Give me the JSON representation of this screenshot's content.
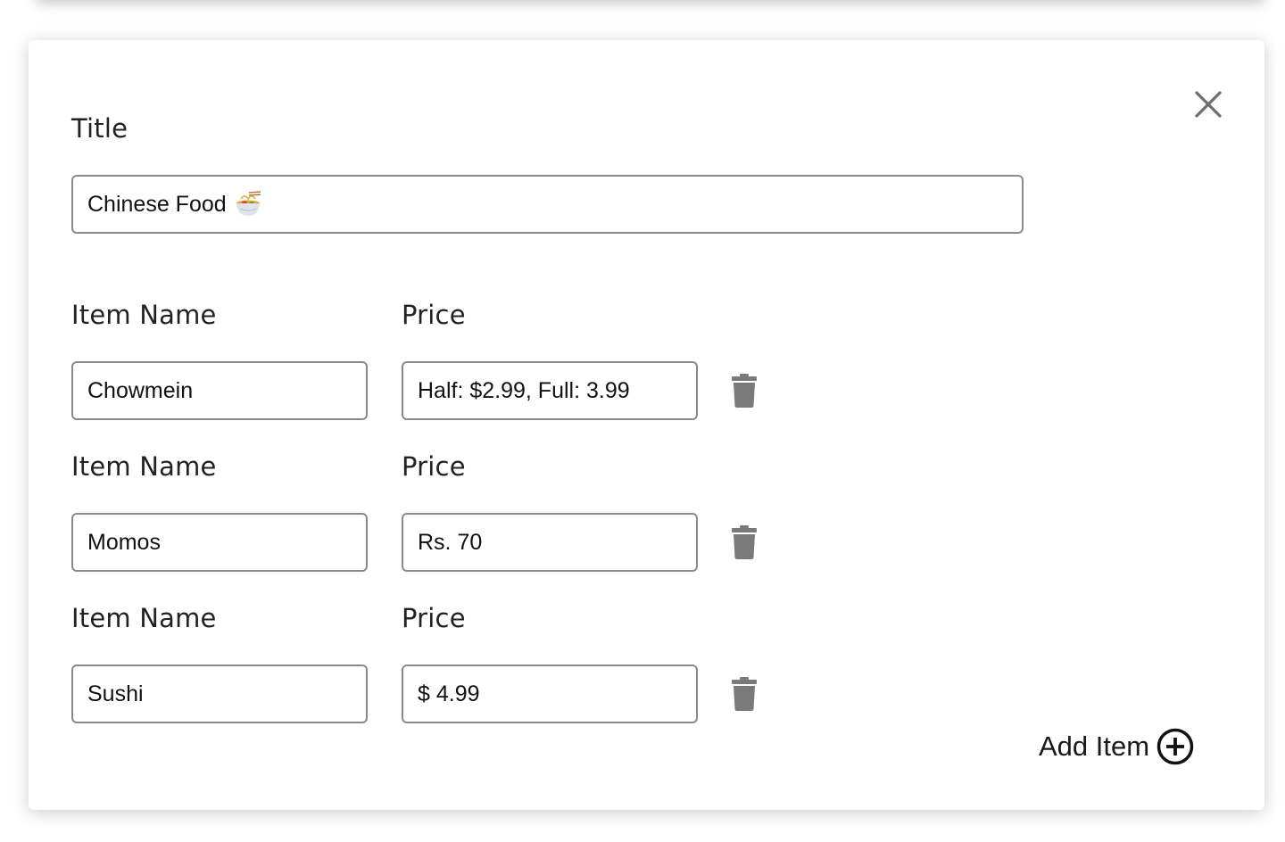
{
  "form": {
    "title_label": "Title",
    "title_value": "Chinese Food",
    "title_emoji_icon": "noodle-bowl-icon",
    "items": [
      {
        "name_label": "Item Name",
        "name_value": "Chowmein",
        "price_label": "Price",
        "price_value": "Half: $2.99, Full: 3.99"
      },
      {
        "name_label": "Item Name",
        "name_value": "Momos",
        "price_label": "Price",
        "price_value": "Rs. 70"
      },
      {
        "name_label": "Item Name",
        "name_value": "Sushi",
        "price_label": "Price",
        "price_value": "$ 4.99"
      }
    ],
    "add_item_label": "Add Item"
  },
  "icons": {
    "close": "close-icon",
    "delete": "trash-icon",
    "add": "plus-circle-icon"
  },
  "colors": {
    "icon_gray": "#7a7a7a",
    "text_dark": "#222222",
    "border": "#8a8a8a"
  }
}
